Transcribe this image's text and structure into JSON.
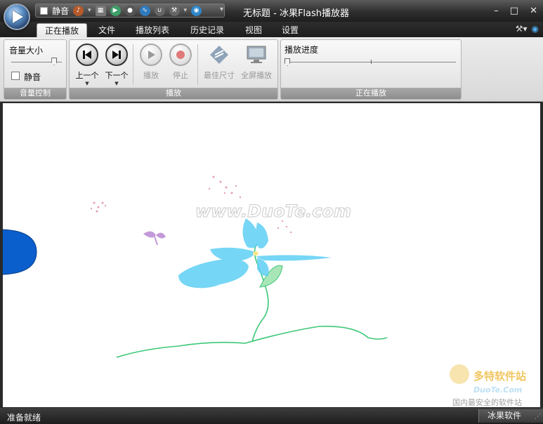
{
  "window": {
    "title": "无标题 - 冰果Flash播放器",
    "controls": {
      "minimize": "–",
      "maximize": "□",
      "close": "✕"
    }
  },
  "qat": {
    "mute_label": "静音",
    "more": "▾"
  },
  "tabs": [
    {
      "label": "正在播放",
      "active": true
    },
    {
      "label": "文件"
    },
    {
      "label": "播放列表"
    },
    {
      "label": "历史记录"
    },
    {
      "label": "视图"
    },
    {
      "label": "设置"
    }
  ],
  "ribbon": {
    "volume_group": {
      "title": "音量大小",
      "mute": "静音",
      "caption": "音量控制",
      "volume_level": 0.85
    },
    "play_group": {
      "prev": "上一个",
      "next": "下一个",
      "play": "播放",
      "stop": "停止",
      "best_size": "最佳尺寸",
      "fullscreen": "全屏播放",
      "caption": "播放"
    },
    "now_group": {
      "title": "播放进度",
      "caption": "正在播放",
      "progress": 0.0
    }
  },
  "content": {
    "watermark": "www.DuoTe.com",
    "logo": {
      "cn": "多特软件站",
      "en": "DuoTe.Com",
      "sub": "国内最安全的软件站"
    }
  },
  "status": {
    "left": "准备就绪",
    "right": "冰果软件"
  },
  "colors": {
    "flower": "#5fd0f5",
    "stem": "#3cc878",
    "leaf": "#a8e6b8",
    "circle": "#0a5fcc",
    "butterfly": "#c39ad9"
  }
}
